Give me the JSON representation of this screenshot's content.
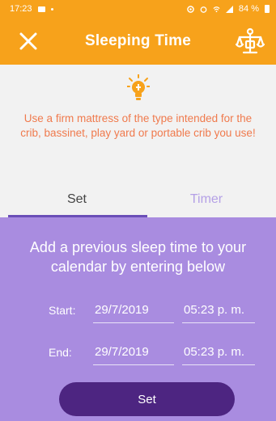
{
  "status_bar": {
    "time": "17:23",
    "battery": "84 %"
  },
  "app_bar": {
    "title": "Sleeping Time",
    "close_icon": "close-icon",
    "scale_icon": "scale-icon"
  },
  "tip": {
    "icon": "lightbulb-icon",
    "text": "Use a firm mattress of the type intended for the crib, bassinet, play yard or portable crib you use!"
  },
  "tabs": [
    {
      "label": "Set",
      "selected": true
    },
    {
      "label": "Timer",
      "selected": false
    }
  ],
  "form": {
    "instruction": "Add a previous sleep time to your calendar by entering below",
    "start": {
      "label": "Start:",
      "date": "29/7/2019",
      "time": "05:23 p. m."
    },
    "end": {
      "label": "End:",
      "date": "29/7/2019",
      "time": "05:23 p. m."
    },
    "submit_label": "Set"
  },
  "colors": {
    "accent_orange": "#f7a21b",
    "tip_text": "#f07a4d",
    "panel_purple": "#a98ce0",
    "button_purple": "#4d2581",
    "tab_indicator": "#6b4fb7"
  }
}
